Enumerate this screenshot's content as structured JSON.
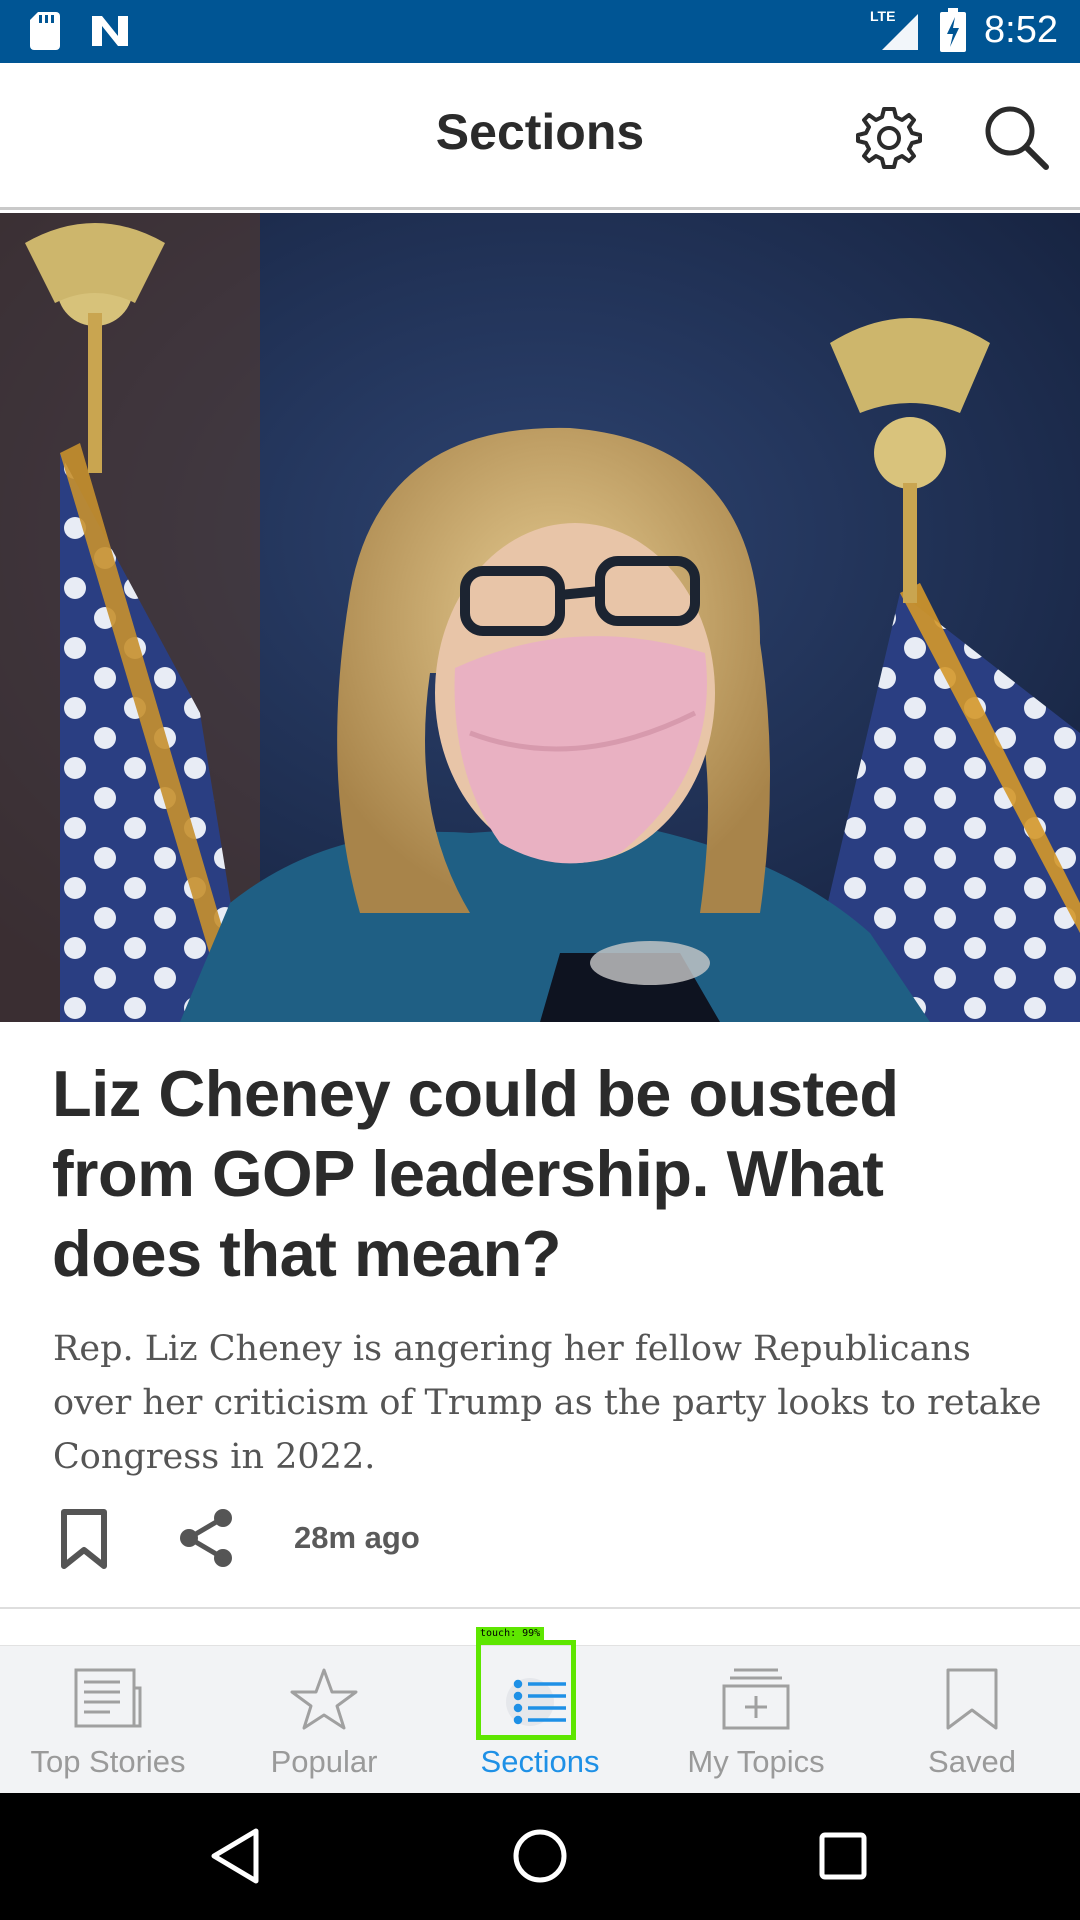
{
  "status_bar": {
    "time": "8:52",
    "network": "LTE",
    "icons": [
      "sd-card-icon",
      "n-logo-icon",
      "lte-signal-icon",
      "battery-charging-icon"
    ]
  },
  "app_bar": {
    "title": "Sections",
    "icons": [
      "gear-icon",
      "search-icon"
    ]
  },
  "article": {
    "headline": "Liz Cheney could be ousted from GOP leadership. What does that mean?",
    "summary": "Rep. Liz Cheney is angering her fellow Republicans over her criticism of Trump as the party looks to retake Congress in 2022.",
    "timestamp": "28m ago",
    "actions": [
      "bookmark-icon",
      "share-icon"
    ]
  },
  "bottom_nav": {
    "items": [
      {
        "label": "Top Stories",
        "icon": "newspaper-icon"
      },
      {
        "label": "Popular",
        "icon": "star-icon"
      },
      {
        "label": "Sections",
        "icon": "list-icon",
        "active": true
      },
      {
        "label": "My Topics",
        "icon": "topics-add-icon"
      },
      {
        "label": "Saved",
        "icon": "bookmark-icon"
      }
    ],
    "touch_indicator": "touch: 99%"
  },
  "colors": {
    "status_bar": "#005594",
    "active": "#1e90e6",
    "inactive": "#9a9a9a"
  }
}
